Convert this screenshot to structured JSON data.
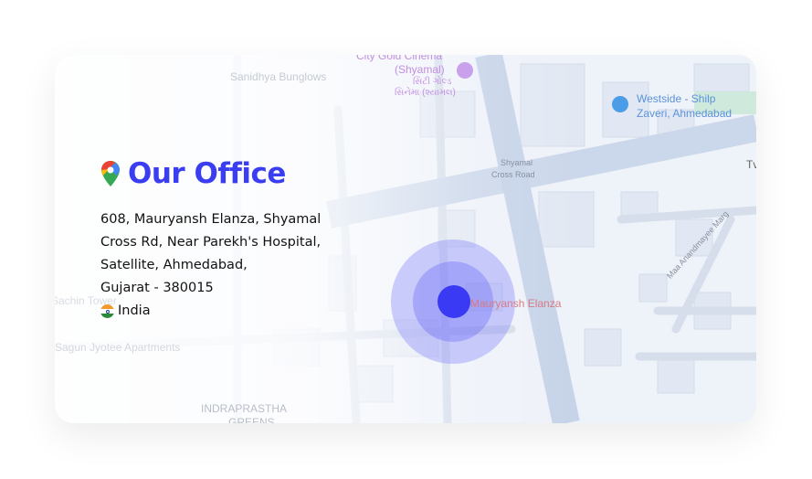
{
  "office": {
    "title": "Our Office",
    "address_lines": [
      "608, Mauryansh Elanza, Shyamal",
      "Cross Rd, Near Parekh's Hospital,",
      "Satellite, Ahmedabad,",
      "Gujarat - 380015"
    ],
    "country": "India"
  },
  "map": {
    "labels": {
      "cinema": "City Gold Cinema",
      "cinema2": "(Shyamal)",
      "cinema_gu1": "સિટી ગોલ્ડ",
      "cinema_gu2": "સિનેમા (શ્યામલ)",
      "sanidhya": "Sanidhya Bunglows",
      "westside1": "Westside - Shilp",
      "westside2": "Zaveri, Ahmedabad",
      "shyamal1": "Shyamal",
      "shyamal2": "Cross Road",
      "mauryansh": "Mauryansh Elanza",
      "road": "Maa Anandmayee Marg",
      "sagun": "Sagun Jyotee Apartments",
      "sachin": "Sachin Tower",
      "indra1": "INDRAPRASTHA",
      "indra2": "GREENS",
      "tw": "Tv"
    },
    "colors": {
      "accent": "#3b3ef0",
      "marker": "#3a3af5",
      "poi_blue": "#4b8fe0",
      "poi_purple": "#b98ae0"
    }
  }
}
